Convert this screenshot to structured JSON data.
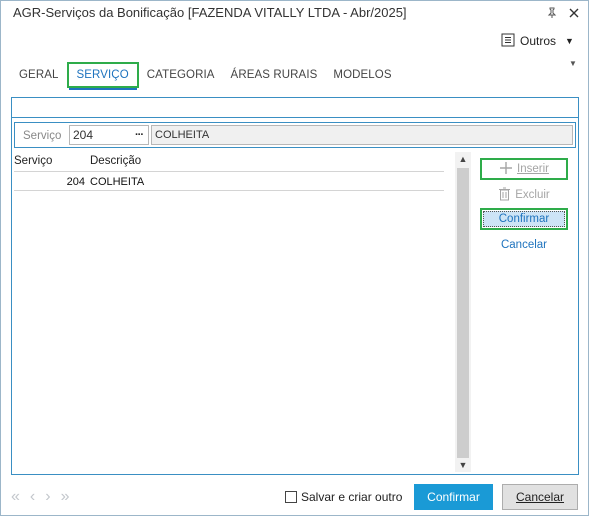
{
  "window": {
    "title": "AGR-Serviços da Bonificação [FAZENDA VITALLY LTDA - Abr/2025]",
    "pin_icon": "pin-icon",
    "close_icon": "close-icon"
  },
  "toolbar": {
    "outros_label": "Outros",
    "outros_icon": "menu-list-icon"
  },
  "tabs": [
    {
      "label": "GERAL",
      "active": false
    },
    {
      "label": "SERVIÇO",
      "active": true
    },
    {
      "label": "CATEGORIA",
      "active": false
    },
    {
      "label": "ÁREAS RURAIS",
      "active": false
    },
    {
      "label": "MODELOS",
      "active": false
    }
  ],
  "search": {
    "label": "Serviço",
    "code": "204",
    "lookup_icon": "ellipsis-icon",
    "description": "COLHEITA"
  },
  "grid": {
    "columns": [
      "Serviço",
      "Descrição"
    ],
    "rows": [
      {
        "servico": "204",
        "descricao": "COLHEITA"
      }
    ]
  },
  "side_actions": {
    "inserir": "Inserir",
    "excluir": "Excluir",
    "confirmar": "Confirmar",
    "cancelar": "Cancelar"
  },
  "footer": {
    "save_and_create_label": "Salvar e criar outro",
    "save_and_create_checked": false,
    "confirm_label": "Confirmar",
    "cancel_label": "Cancelar"
  },
  "colors": {
    "accent": "#1e73be",
    "highlight_outline": "#2eac4a",
    "primary_button": "#1a9ad6"
  }
}
